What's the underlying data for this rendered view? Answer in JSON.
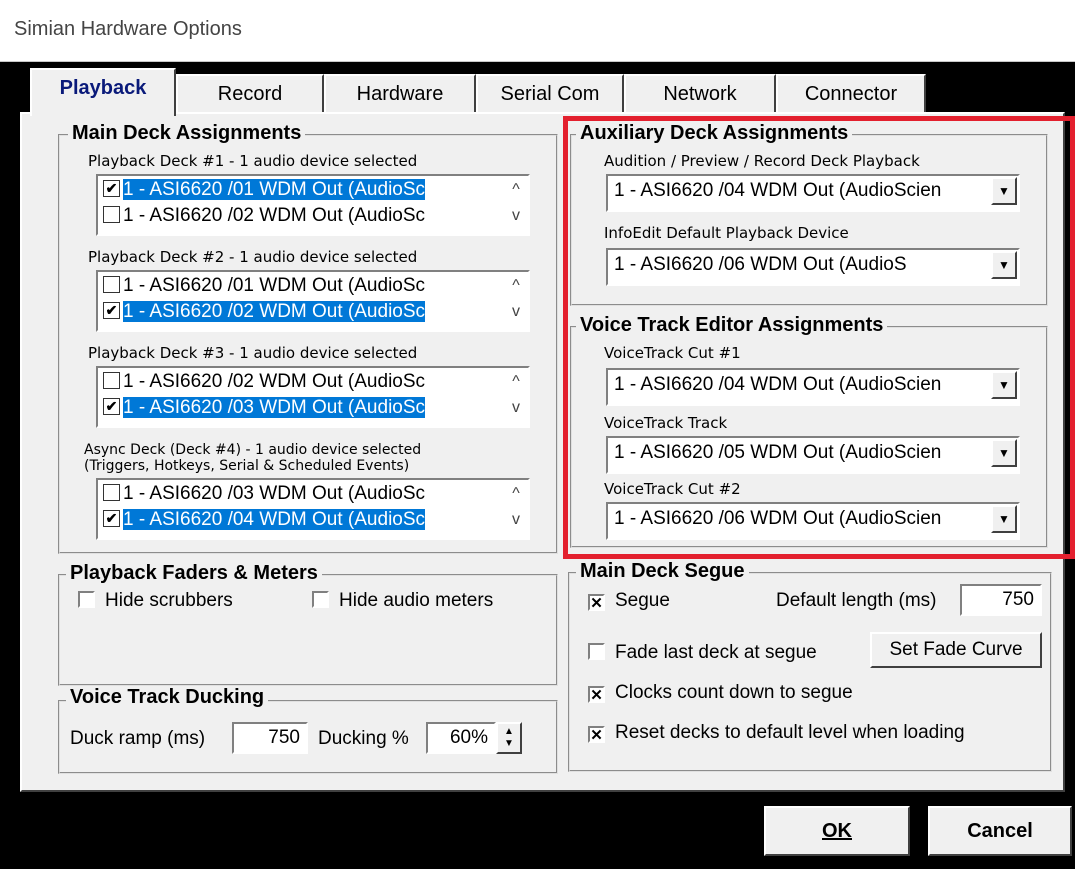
{
  "window": {
    "title": "Simian Hardware Options"
  },
  "tabs": [
    "Playback",
    "Record",
    "Hardware",
    "Serial Com",
    "Network",
    "Connector"
  ],
  "main_deck": {
    "legend": "Main Deck Assignments",
    "decks": [
      {
        "label": "Playback Deck #1 - 1 audio device selected",
        "items": [
          {
            "text": "1 - ASI6620 /01 WDM Out (AudioSc",
            "checked": true
          },
          {
            "text": "1 - ASI6620 /02 WDM Out (AudioSc",
            "checked": false
          }
        ]
      },
      {
        "label": "Playback Deck #2 - 1 audio device selected",
        "items": [
          {
            "text": "1 - ASI6620 /01 WDM Out (AudioSc",
            "checked": false
          },
          {
            "text": "1 - ASI6620 /02 WDM Out (AudioSc",
            "checked": true
          }
        ]
      },
      {
        "label": "Playback Deck #3 - 1 audio device selected",
        "items": [
          {
            "text": "1 - ASI6620 /02 WDM Out (AudioSc",
            "checked": false
          },
          {
            "text": "1 - ASI6620 /03 WDM Out (AudioSc",
            "checked": true
          }
        ]
      },
      {
        "label": "Async Deck (Deck #4) - 1 audio device selected",
        "label2": "(Triggers, Hotkeys, Serial & Scheduled Events)",
        "items": [
          {
            "text": "1 - ASI6620 /03 WDM Out (AudioSc",
            "checked": false
          },
          {
            "text": "1 - ASI6620 /04 WDM Out (AudioSc",
            "checked": true
          }
        ]
      }
    ]
  },
  "aux": {
    "legend": "Auxiliary Deck Assignments",
    "audition_label": "Audition / Preview / Record Deck Playback",
    "audition_value": "1 - ASI6620 /04 WDM Out (AudioScien",
    "infoedit_label": "InfoEdit Default Playback Device",
    "infoedit_value": "1 - ASI6620 /06 WDM Out (AudioS"
  },
  "vt_editor": {
    "legend": "Voice Track Editor Assignments",
    "cut1_label": "VoiceTrack Cut #1",
    "cut1_value": "1 - ASI6620 /04 WDM Out (AudioScien",
    "track_label": "VoiceTrack Track",
    "track_value": "1 - ASI6620 /05 WDM Out (AudioScien",
    "cut2_label": "VoiceTrack Cut #2",
    "cut2_value": "1 - ASI6620 /06 WDM Out (AudioScien"
  },
  "faders": {
    "legend": "Playback Faders & Meters",
    "hide_scrubbers": "Hide scrubbers",
    "hide_meters": "Hide audio meters"
  },
  "ducking": {
    "legend": "Voice Track Ducking",
    "ramp_label": "Duck ramp (ms)",
    "ramp_value": "750",
    "pct_label": "Ducking %",
    "pct_value": "60%"
  },
  "segue": {
    "legend": "Main Deck Segue",
    "segue_label": "Segue",
    "default_length_label": "Default length (ms)",
    "default_length_value": "750",
    "fade_last": "Fade last deck at segue",
    "set_fade_curve": "Set Fade Curve",
    "clocks": "Clocks count down to segue",
    "reset": "Reset decks to default level when loading"
  },
  "footer": {
    "ok": "OK",
    "cancel": "Cancel"
  },
  "colors": {
    "highlight": "#e3202e",
    "selection": "#0078d7",
    "active_tab_text": "#0a1a7a"
  }
}
